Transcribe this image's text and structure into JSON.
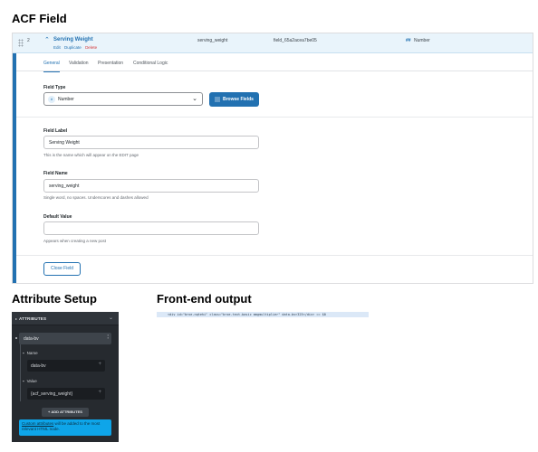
{
  "headings": {
    "acf_field": "ACF Field",
    "attribute_setup": "Attribute Setup",
    "front_end_output": "Front-end output"
  },
  "acf": {
    "row": {
      "order": "2",
      "label": "Serving Weight",
      "actions": {
        "edit": "Edit",
        "duplicate": "Duplicate",
        "delete": "Delete"
      },
      "name": "serving_weight",
      "key": "field_65a2acea7be05",
      "type": "Number"
    },
    "tabs": [
      "General",
      "Validation",
      "Presentation",
      "Conditional Logic"
    ],
    "active_tab": "General",
    "field_type": {
      "label": "Field Type",
      "value": "Number",
      "browse_label": "Browse Fields"
    },
    "field_label": {
      "label": "Field Label",
      "value": "Serving Weight",
      "help": "This is the name which will appear on the EDIT page"
    },
    "field_name": {
      "label": "Field Name",
      "value": "serving_weight",
      "help": "Single word, no spaces. Underscores and dashes allowed"
    },
    "default_value": {
      "label": "Default Value",
      "value": "",
      "help": "Appears when creating a new post"
    },
    "close_label": "Close Field",
    "accent_color": "#2271b1"
  },
  "attributes": {
    "panel_title": "ATTRIBUTES",
    "item": "data-bv",
    "name_label": "Name",
    "name_value": "data-bv",
    "value_label": "Value",
    "value_value": "{acf_serving_weight}",
    "add_label": "+ ADD ATTRIBUTES",
    "info_link": "Custom attributes",
    "info_text": " will be added to the most relevant HTML node."
  },
  "output": {
    "code": "<div id=\"brxe-nqtehi\" class=\"brxe-text-basic mmgmultiplier\" data-bv>325</div> == $0"
  }
}
